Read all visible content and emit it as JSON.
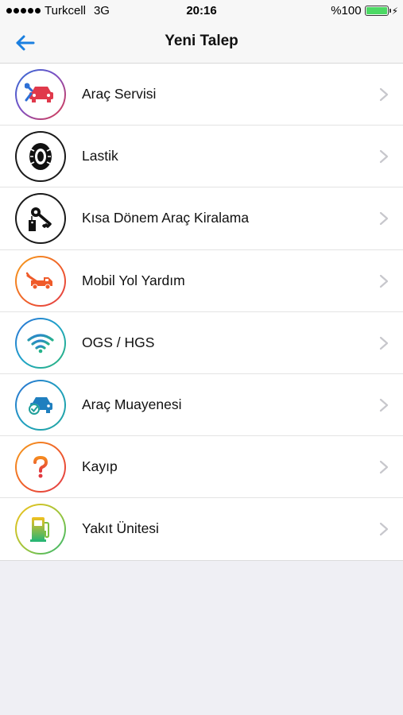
{
  "status_bar": {
    "carrier": "Turkcell",
    "network": "3G",
    "time": "20:16",
    "battery": "%100"
  },
  "nav": {
    "title": "Yeni Talep"
  },
  "menu": [
    {
      "label": "Araç Servisi",
      "icon": "car-service-icon"
    },
    {
      "label": "Lastik",
      "icon": "tire-icon"
    },
    {
      "label": "Kısa Dönem Araç Kiralama",
      "icon": "car-key-icon"
    },
    {
      "label": "Mobil Yol Yardım",
      "icon": "tow-truck-icon"
    },
    {
      "label": "OGS / HGS",
      "icon": "wifi-icon"
    },
    {
      "label": "Araç Muayenesi",
      "icon": "car-check-icon"
    },
    {
      "label": "Kayıp",
      "icon": "question-icon"
    },
    {
      "label": "Yakıt Ünitesi",
      "icon": "fuel-pump-icon"
    }
  ],
  "colors": {
    "accent": "#1a7fe0",
    "chevron": "#c7c7cc"
  }
}
